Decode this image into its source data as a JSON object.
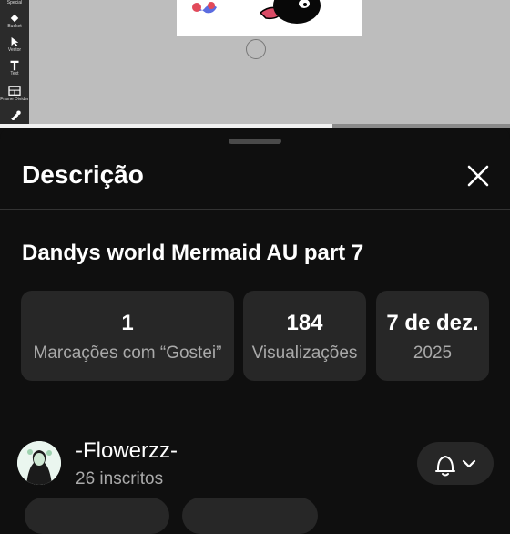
{
  "toolbar": {
    "tools": [
      "Special",
      "Bucket",
      "Vector",
      "Text",
      "Frame Divider"
    ]
  },
  "sheet": {
    "title": "Descrição",
    "video_title": "Dandys world Mermaid AU part 7",
    "stats": [
      {
        "value": "1",
        "label": "Marcações com “Gostei”"
      },
      {
        "value": "184",
        "label": "Visualizações"
      },
      {
        "value": "7 de dez.",
        "label": "2025"
      }
    ],
    "channel": {
      "name": "-Flowerzz-",
      "subscribers": "26 inscritos"
    }
  },
  "colors": {
    "sheet_bg": "#0f0f0f",
    "card_bg": "#272727",
    "secondary_text": "#aaaaaa"
  }
}
